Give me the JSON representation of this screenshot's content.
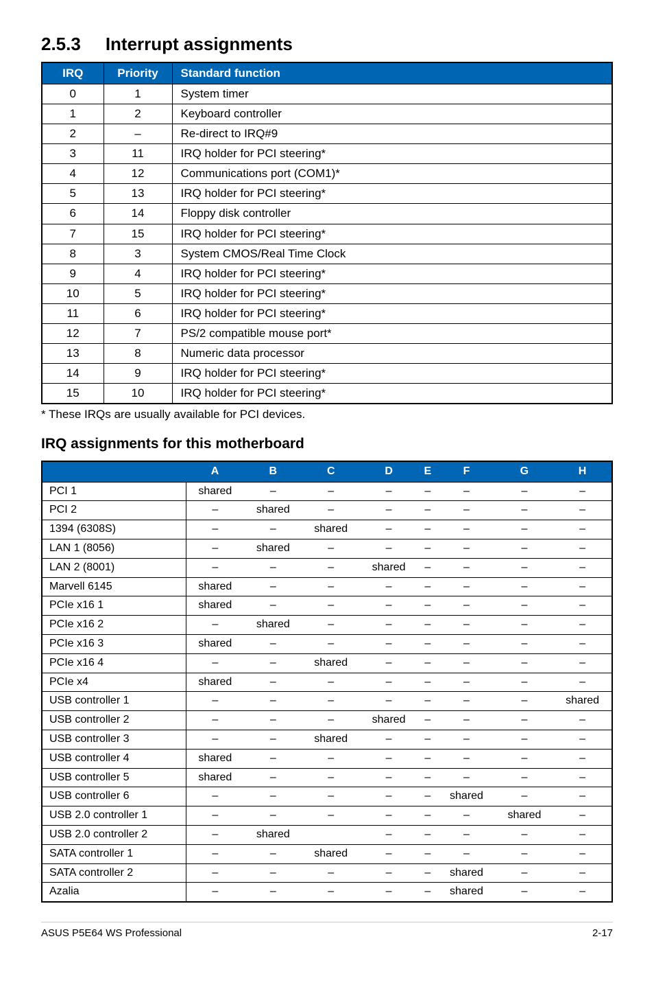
{
  "section": {
    "number": "2.5.3",
    "title": "Interrupt assignments"
  },
  "irq_table": {
    "headers": [
      "IRQ",
      "Priority",
      "Standard function"
    ],
    "rows": [
      {
        "irq": "0",
        "priority": "1",
        "fn": "System timer"
      },
      {
        "irq": "1",
        "priority": "2",
        "fn": "Keyboard controller"
      },
      {
        "irq": "2",
        "priority": "–",
        "fn": "Re-direct to IRQ#9"
      },
      {
        "irq": "3",
        "priority": "11",
        "fn": "IRQ holder for PCI steering*"
      },
      {
        "irq": "4",
        "priority": "12",
        "fn": "Communications port (COM1)*"
      },
      {
        "irq": "5",
        "priority": "13",
        "fn": "IRQ holder for PCI steering*"
      },
      {
        "irq": "6",
        "priority": "14",
        "fn": "Floppy disk controller"
      },
      {
        "irq": "7",
        "priority": "15",
        "fn": "IRQ holder for PCI steering*"
      },
      {
        "irq": "8",
        "priority": "3",
        "fn": "System CMOS/Real Time Clock"
      },
      {
        "irq": "9",
        "priority": "4",
        "fn": "IRQ holder for PCI steering*"
      },
      {
        "irq": "10",
        "priority": "5",
        "fn": "IRQ holder for PCI steering*"
      },
      {
        "irq": "11",
        "priority": "6",
        "fn": "IRQ holder for PCI steering*"
      },
      {
        "irq": "12",
        "priority": "7",
        "fn": "PS/2 compatible mouse port*"
      },
      {
        "irq": "13",
        "priority": "8",
        "fn": "Numeric data processor"
      },
      {
        "irq": "14",
        "priority": "9",
        "fn": "IRQ holder for PCI steering*"
      },
      {
        "irq": "15",
        "priority": "10",
        "fn": "IRQ holder for PCI steering*"
      }
    ]
  },
  "footnote": "* These IRQs are usually available for PCI devices.",
  "subheading": "IRQ assignments for this motherboard",
  "assign_table": {
    "headers": [
      "",
      "A",
      "B",
      "C",
      "D",
      "E",
      "F",
      "G",
      "H"
    ],
    "rows": [
      {
        "label": "PCI 1",
        "cells": [
          "shared",
          "–",
          "–",
          "–",
          "–",
          "–",
          "–",
          "–"
        ]
      },
      {
        "label": "PCI 2",
        "cells": [
          "–",
          "shared",
          "–",
          "–",
          "–",
          "–",
          "–",
          "–"
        ]
      },
      {
        "label": "1394 (6308S)",
        "cells": [
          "–",
          "–",
          "shared",
          "–",
          "–",
          "–",
          "–",
          "–"
        ]
      },
      {
        "label": "LAN 1 (8056)",
        "cells": [
          "–",
          "shared",
          "–",
          "–",
          "–",
          "–",
          "–",
          "–"
        ]
      },
      {
        "label": "LAN 2 (8001)",
        "cells": [
          "–",
          "–",
          "–",
          "shared",
          "–",
          "–",
          "–",
          "–"
        ]
      },
      {
        "label": "Marvell 6145",
        "cells": [
          "shared",
          "–",
          "–",
          "–",
          "–",
          "–",
          "–",
          "–"
        ]
      },
      {
        "label": "PCIe x16 1",
        "cells": [
          "shared",
          "–",
          "–",
          "–",
          "–",
          "–",
          "–",
          "–"
        ]
      },
      {
        "label": "PCIe x16 2",
        "cells": [
          "–",
          "shared",
          "–",
          "–",
          "–",
          "–",
          "–",
          "–"
        ]
      },
      {
        "label": "PCIe x16 3",
        "cells": [
          "shared",
          "–",
          "–",
          "–",
          "–",
          "–",
          "–",
          "–"
        ]
      },
      {
        "label": "PCIe x16 4",
        "cells": [
          "–",
          "–",
          "shared",
          "–",
          "–",
          "–",
          "–",
          "–"
        ]
      },
      {
        "label": "PCIe x4",
        "cells": [
          "shared",
          "–",
          "–",
          "–",
          "–",
          "–",
          "–",
          "–"
        ]
      },
      {
        "label": "USB controller 1",
        "cells": [
          "–",
          "–",
          "–",
          "–",
          "–",
          "–",
          "–",
          "shared"
        ]
      },
      {
        "label": "USB controller 2",
        "cells": [
          "–",
          "–",
          "–",
          "shared",
          "–",
          "–",
          "–",
          "–"
        ]
      },
      {
        "label": "USB controller 3",
        "cells": [
          "–",
          "–",
          "shared",
          "–",
          "–",
          "–",
          "–",
          "–"
        ]
      },
      {
        "label": "USB controller 4",
        "cells": [
          "shared",
          "–",
          "–",
          "–",
          "–",
          "–",
          "–",
          "–"
        ]
      },
      {
        "label": "USB controller 5",
        "cells": [
          "shared",
          "–",
          "–",
          "–",
          "–",
          "–",
          "–",
          "–"
        ]
      },
      {
        "label": "USB controller 6",
        "cells": [
          "–",
          "–",
          "–",
          "–",
          "–",
          "shared",
          "–",
          "–"
        ]
      },
      {
        "label": "USB 2.0 controller 1",
        "cells": [
          "–",
          "–",
          "–",
          "–",
          "–",
          "–",
          "shared",
          "–"
        ]
      },
      {
        "label": "USB 2.0 controller 2",
        "cells": [
          "–",
          "shared",
          "",
          "–",
          "–",
          "–",
          "–",
          "–"
        ]
      },
      {
        "label": "SATA controller 1",
        "cells": [
          "–",
          "–",
          "shared",
          "–",
          "–",
          "–",
          "–",
          "–"
        ]
      },
      {
        "label": "SATA controller 2",
        "cells": [
          "–",
          "–",
          "–",
          "–",
          "–",
          "shared",
          "–",
          "–"
        ]
      },
      {
        "label": "Azalia",
        "cells": [
          "–",
          "–",
          "–",
          "–",
          "–",
          "shared",
          "–",
          "–"
        ]
      }
    ]
  },
  "footer": {
    "left": "ASUS P5E64 WS Professional",
    "right": "2-17"
  }
}
